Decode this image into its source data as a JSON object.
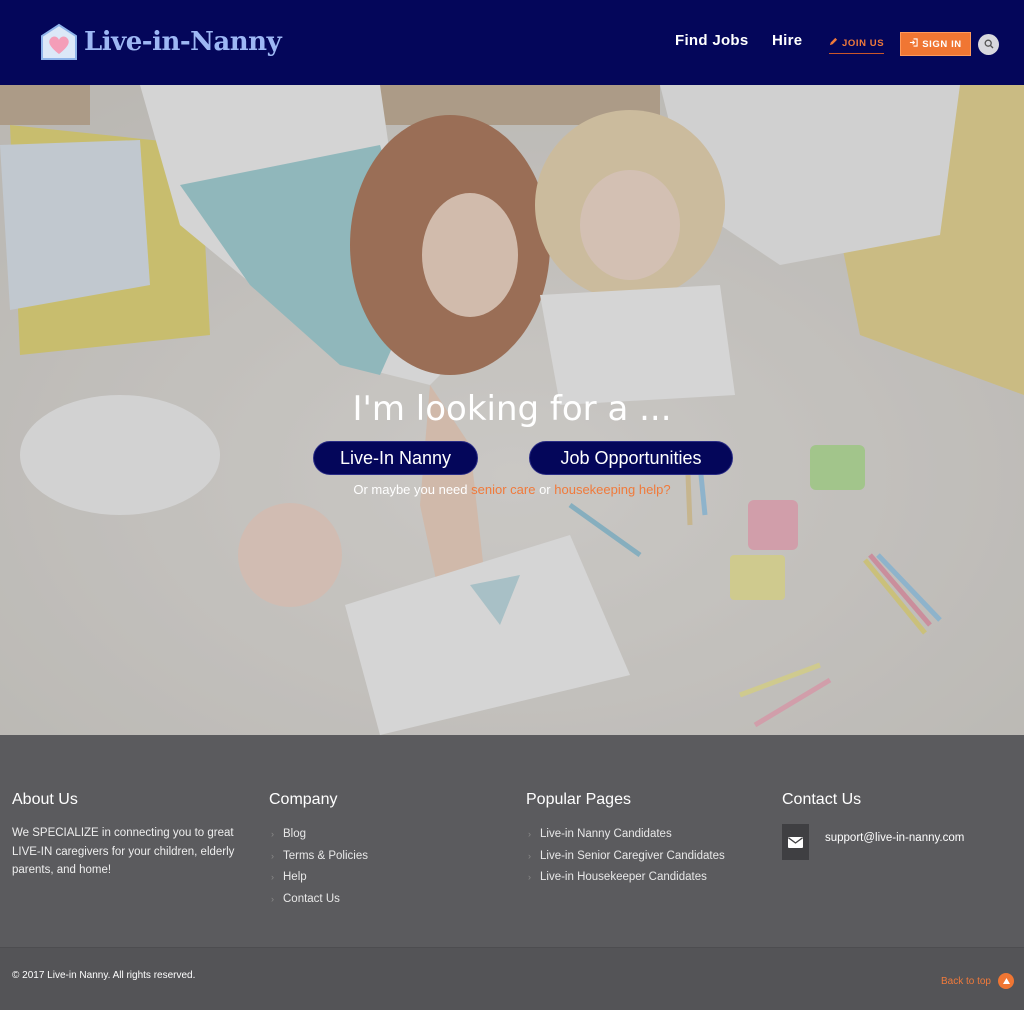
{
  "header": {
    "logo_text": "Live-in-Nanny",
    "nav": {
      "find_jobs": "Find Jobs",
      "hire": "Hire",
      "join_us": "JOIN US",
      "sign_in": "SIGN IN"
    },
    "icons": {
      "logo": "house-heart-icon",
      "join": "pencil-icon",
      "sign_in": "sign-in-icon",
      "search": "search-icon"
    }
  },
  "hero": {
    "title": "I'm looking for a ...",
    "btn_nanny": "Live-In Nanny",
    "btn_jobs": "Job Opportunities",
    "sub_prefix": "Or maybe you need",
    "sub_link1": "senior care",
    "sub_or": "or",
    "sub_link2": "housekeeping help?"
  },
  "footer": {
    "about": {
      "title": "About Us",
      "text": "We SPECIALIZE in connecting you to great LIVE-IN caregivers for your children, elderly parents, and home!"
    },
    "company": {
      "title": "Company",
      "items": [
        "Blog",
        "Terms & Policies",
        "Help",
        "Contact Us"
      ]
    },
    "popular": {
      "title": "Popular Pages",
      "items": [
        "Live-in Nanny Candidates",
        "Live-in Senior Caregiver Candidates",
        "Live-in Housekeeper Candidates"
      ]
    },
    "contact": {
      "title": "Contact Us",
      "email": "support@live-in-nanny.com",
      "icon": "envelope-icon"
    },
    "copyright": "© 2017 Live-in Nanny. All rights reserved.",
    "back_to_top": "Back to top"
  },
  "colors": {
    "header_bg": "#04065a",
    "accent": "#f07633",
    "footer_bg": "#5b5b5e",
    "logo_text": "#9db7f4"
  }
}
